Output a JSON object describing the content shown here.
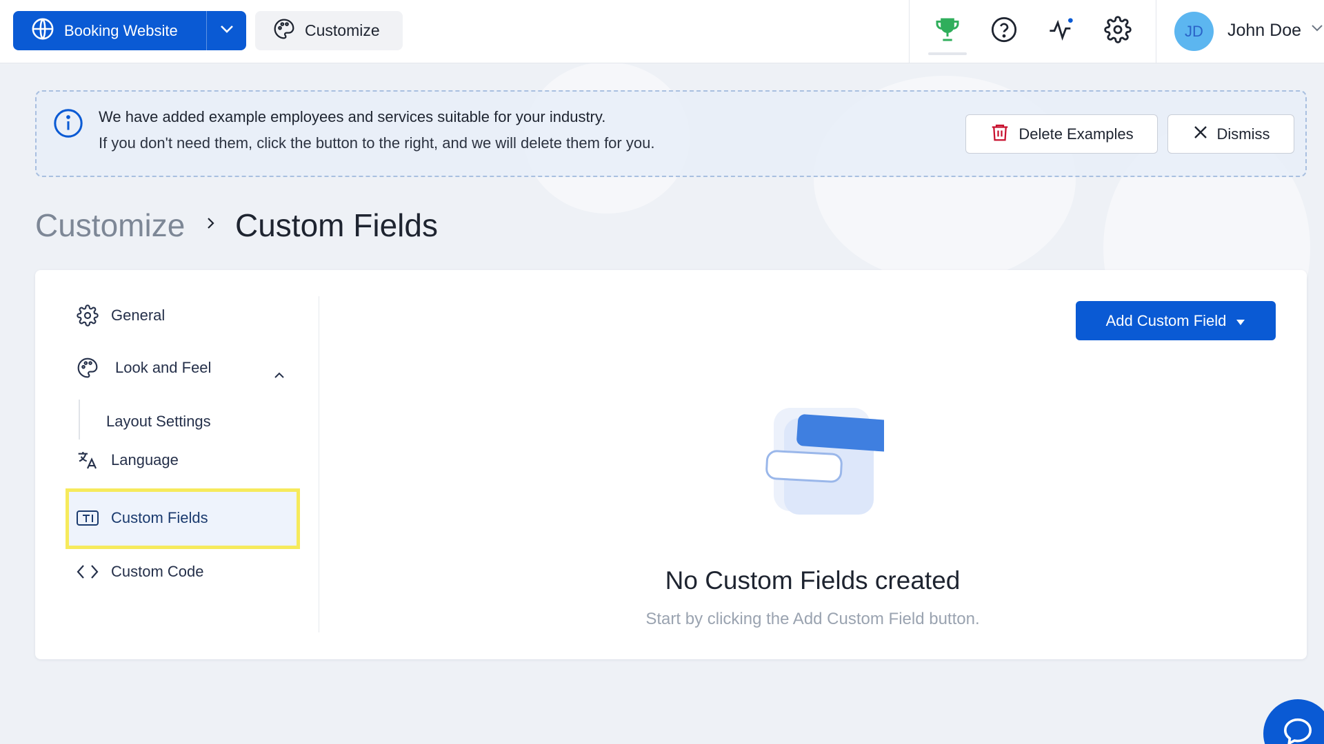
{
  "topbar": {
    "site_selector_label": "Booking Website",
    "customize_label": "Customize",
    "user": {
      "initials": "JD",
      "name": "John Doe"
    },
    "icons": [
      "globe-icon",
      "chevron-down-icon",
      "palette-icon",
      "trophy-icon",
      "help-icon",
      "activity-icon",
      "settings-icon"
    ]
  },
  "banner": {
    "line1": "We have added example employees and services suitable for your industry.",
    "line2": "If you don't need them, click the button to the right, and we will delete them for you.",
    "delete_label": "Delete Examples",
    "dismiss_label": "Dismiss"
  },
  "breadcrumb": {
    "parent": "Customize",
    "current": "Custom Fields"
  },
  "sidebar": {
    "items": [
      {
        "label": "General",
        "icon": "gear-icon"
      },
      {
        "label": "Look and Feel",
        "icon": "palette-icon",
        "expanded": true,
        "children": [
          {
            "label": "Layout Settings"
          }
        ]
      },
      {
        "label": "Language",
        "icon": "translate-icon"
      },
      {
        "label": "Custom Fields",
        "icon": "text-field-icon",
        "active": true
      },
      {
        "label": "Custom Code",
        "icon": "code-icon"
      }
    ]
  },
  "main": {
    "add_button_label": "Add Custom Field",
    "empty_title": "No Custom Fields created",
    "empty_subtitle": "Start by clicking the Add Custom Field button."
  },
  "colors": {
    "primary": "#0a5ad4",
    "highlight": "#f6ea5c",
    "trophy": "#2fae5b",
    "delete_icon": "#c8102e"
  }
}
